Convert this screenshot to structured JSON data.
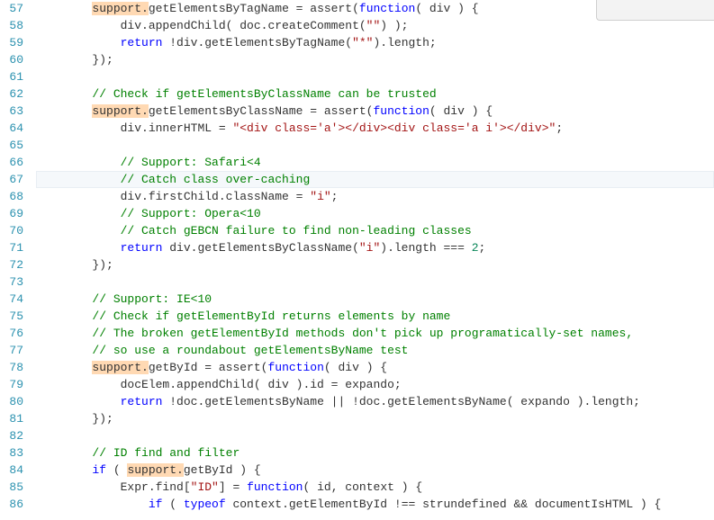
{
  "startLine": 57,
  "currentLine": 67,
  "lines": [
    {
      "indent": 2,
      "segs": [
        {
          "t": "support.",
          "c": "tok-hl"
        },
        {
          "t": "getElementsByTagName = assert(",
          "c": "tok-prop"
        },
        {
          "t": "function",
          "c": "tok-kw"
        },
        {
          "t": "( div ) {",
          "c": "tok-prop"
        }
      ]
    },
    {
      "indent": 3,
      "segs": [
        {
          "t": "div.appendChild( doc.createComment(",
          "c": "tok-prop"
        },
        {
          "t": "\"\"",
          "c": "tok-str"
        },
        {
          "t": ") );",
          "c": "tok-prop"
        }
      ]
    },
    {
      "indent": 3,
      "segs": [
        {
          "t": "return",
          "c": "tok-kw"
        },
        {
          "t": " !div.getElementsByTagName(",
          "c": "tok-prop"
        },
        {
          "t": "\"*\"",
          "c": "tok-str"
        },
        {
          "t": ").length;",
          "c": "tok-prop"
        }
      ]
    },
    {
      "indent": 2,
      "segs": [
        {
          "t": "});",
          "c": "tok-prop"
        }
      ]
    },
    {
      "indent": 0,
      "segs": []
    },
    {
      "indent": 2,
      "segs": [
        {
          "t": "// Check if getElementsByClassName can be trusted",
          "c": "tok-com"
        }
      ]
    },
    {
      "indent": 2,
      "segs": [
        {
          "t": "support.",
          "c": "tok-hl"
        },
        {
          "t": "getElementsByClassName = assert(",
          "c": "tok-prop"
        },
        {
          "t": "function",
          "c": "tok-kw"
        },
        {
          "t": "( div ) {",
          "c": "tok-prop"
        }
      ]
    },
    {
      "indent": 3,
      "segs": [
        {
          "t": "div.innerHTML = ",
          "c": "tok-prop"
        },
        {
          "t": "\"<div class='a'></div><div class='a i'></div>\"",
          "c": "tok-str"
        },
        {
          "t": ";",
          "c": "tok-prop"
        }
      ]
    },
    {
      "indent": 0,
      "segs": []
    },
    {
      "indent": 3,
      "segs": [
        {
          "t": "// Support: Safari<4",
          "c": "tok-com"
        }
      ]
    },
    {
      "indent": 3,
      "segs": [
        {
          "t": "// Catch class over-caching",
          "c": "tok-com"
        }
      ]
    },
    {
      "indent": 3,
      "segs": [
        {
          "t": "div.firstChild.className = ",
          "c": "tok-prop"
        },
        {
          "t": "\"i\"",
          "c": "tok-str"
        },
        {
          "t": ";",
          "c": "tok-prop"
        }
      ]
    },
    {
      "indent": 3,
      "segs": [
        {
          "t": "// Support: Opera<10",
          "c": "tok-com"
        }
      ]
    },
    {
      "indent": 3,
      "segs": [
        {
          "t": "// Catch gEBCN failure to find non-leading classes",
          "c": "tok-com"
        }
      ]
    },
    {
      "indent": 3,
      "segs": [
        {
          "t": "return",
          "c": "tok-kw"
        },
        {
          "t": " div.getElementsByClassName(",
          "c": "tok-prop"
        },
        {
          "t": "\"i\"",
          "c": "tok-str"
        },
        {
          "t": ").length === ",
          "c": "tok-prop"
        },
        {
          "t": "2",
          "c": "tok-num"
        },
        {
          "t": ";",
          "c": "tok-prop"
        }
      ]
    },
    {
      "indent": 2,
      "segs": [
        {
          "t": "});",
          "c": "tok-prop"
        }
      ]
    },
    {
      "indent": 0,
      "segs": []
    },
    {
      "indent": 2,
      "segs": [
        {
          "t": "// Support: IE<10",
          "c": "tok-com"
        }
      ]
    },
    {
      "indent": 2,
      "segs": [
        {
          "t": "// Check if getElementById returns elements by name",
          "c": "tok-com"
        }
      ]
    },
    {
      "indent": 2,
      "segs": [
        {
          "t": "// The broken getElementById methods don't pick up programatically-set names,",
          "c": "tok-com"
        }
      ]
    },
    {
      "indent": 2,
      "segs": [
        {
          "t": "// so use a roundabout getElementsByName test",
          "c": "tok-com"
        }
      ]
    },
    {
      "indent": 2,
      "segs": [
        {
          "t": "support.",
          "c": "tok-hl"
        },
        {
          "t": "getById = assert(",
          "c": "tok-prop"
        },
        {
          "t": "function",
          "c": "tok-kw"
        },
        {
          "t": "( div ) {",
          "c": "tok-prop"
        }
      ]
    },
    {
      "indent": 3,
      "segs": [
        {
          "t": "docElem.appendChild( div ).id = expando;",
          "c": "tok-prop"
        }
      ]
    },
    {
      "indent": 3,
      "segs": [
        {
          "t": "return",
          "c": "tok-kw"
        },
        {
          "t": " !doc.getElementsByName || !doc.getElementsByName( expando ).length;",
          "c": "tok-prop"
        }
      ]
    },
    {
      "indent": 2,
      "segs": [
        {
          "t": "});",
          "c": "tok-prop"
        }
      ]
    },
    {
      "indent": 0,
      "segs": []
    },
    {
      "indent": 2,
      "segs": [
        {
          "t": "// ID find and filter",
          "c": "tok-com"
        }
      ]
    },
    {
      "indent": 2,
      "segs": [
        {
          "t": "if",
          "c": "tok-kw"
        },
        {
          "t": " ( ",
          "c": "tok-prop"
        },
        {
          "t": "support.",
          "c": "tok-hl"
        },
        {
          "t": "getById ) {",
          "c": "tok-prop"
        }
      ]
    },
    {
      "indent": 3,
      "segs": [
        {
          "t": "Expr.find[",
          "c": "tok-prop"
        },
        {
          "t": "\"ID\"",
          "c": "tok-str"
        },
        {
          "t": "] = ",
          "c": "tok-prop"
        },
        {
          "t": "function",
          "c": "tok-kw"
        },
        {
          "t": "( id, context ) {",
          "c": "tok-prop"
        }
      ]
    },
    {
      "indent": 4,
      "segs": [
        {
          "t": "if",
          "c": "tok-kw"
        },
        {
          "t": " ( ",
          "c": "tok-prop"
        },
        {
          "t": "typeof",
          "c": "tok-kw"
        },
        {
          "t": " context.getElementById !== strundefined && documentIsHTML ) {",
          "c": "tok-prop"
        }
      ]
    }
  ],
  "tabSize": 4
}
